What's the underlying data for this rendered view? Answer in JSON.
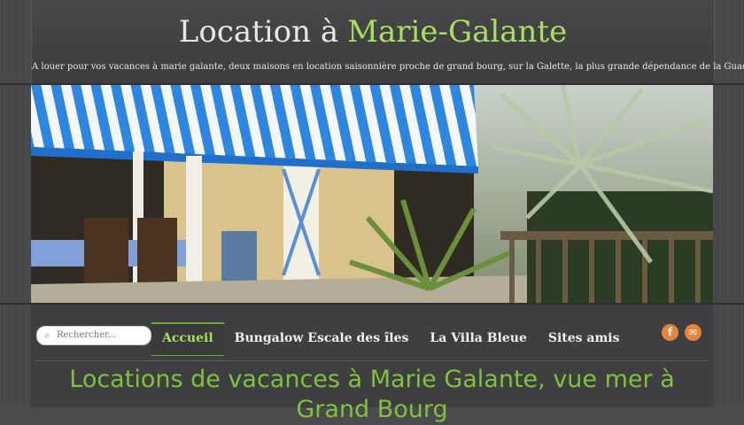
{
  "header": {
    "title_main": "Location à",
    "title_accent": "Marie-Galante",
    "tagline": "A louer pour vos vacances à marie galante, deux maisons en location saisonnière proche de grand bourg, sur la Galette, la plus grande dépendance de la Guadeloupe."
  },
  "search": {
    "placeholder": "Rechercher..."
  },
  "nav": {
    "items": [
      {
        "label": "Accueil"
      },
      {
        "label": "Bungalow Escale des îles"
      },
      {
        "label": "La Villa Bleue"
      },
      {
        "label": "Sites amis"
      }
    ]
  },
  "social": {
    "facebook_icon": "facebook-icon",
    "mail_icon": "mail-icon"
  },
  "main": {
    "heading_line1": "Locations de vacances à Marie Galante, vue mer à",
    "heading_line2": "Grand Bourg"
  },
  "colors": {
    "accent": "#a8e060",
    "heading": "#7ec23e",
    "background": "#4a494c",
    "social": "#e8833a"
  }
}
